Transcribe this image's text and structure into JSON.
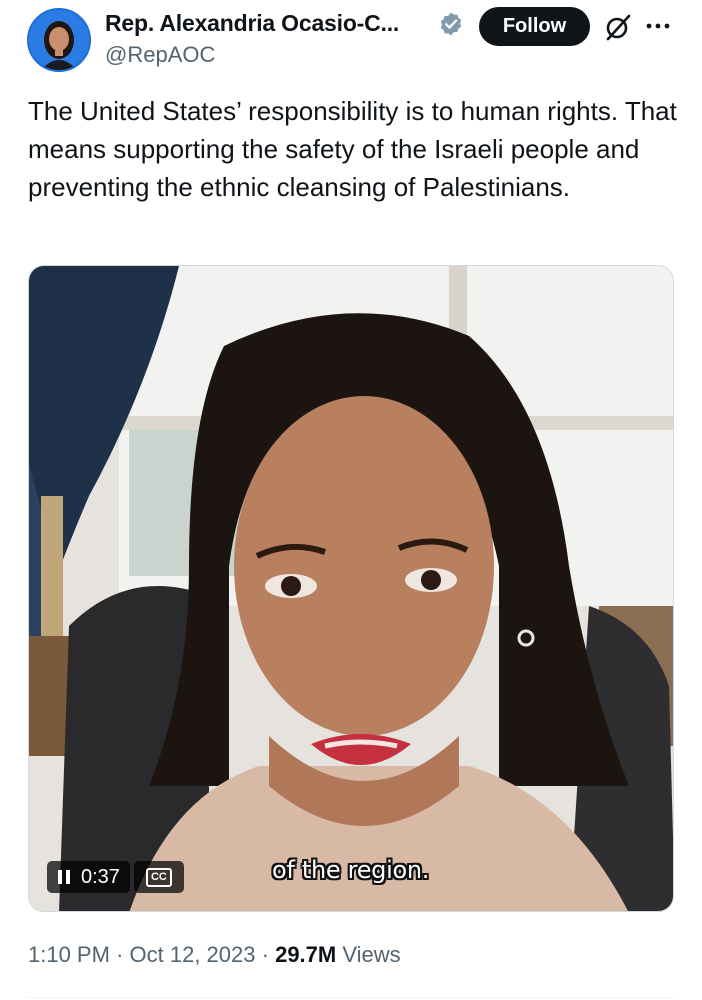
{
  "author": {
    "display_name": "Rep. Alexandria Ocasio-C...",
    "handle": "@RepAOC",
    "avatar_icon": "profile-photo",
    "verified_icon": "verified-badge-icon",
    "verified_color": "#829aab"
  },
  "actions": {
    "follow_label": "Follow",
    "grok_icon": "grok-icon",
    "more_icon": "more-icon"
  },
  "tweet": {
    "text": "The United States’ responsibility is to human rights. That means supporting the safety of the Israeli people and preventing the ethnic cleansing of Palestinians."
  },
  "video": {
    "caption": "of the region.",
    "time": "0:37",
    "pause_icon": "pause-icon",
    "cc_label": "CC"
  },
  "meta": {
    "time": "1:10 PM",
    "separator": "·",
    "date": "Oct 12, 2023",
    "views_count": "29.7M",
    "views_label": "Views"
  },
  "colors": {
    "text_primary": "#0f1419",
    "text_secondary": "#536471",
    "follow_bg": "#0f1419",
    "border": "#cfd9de"
  }
}
